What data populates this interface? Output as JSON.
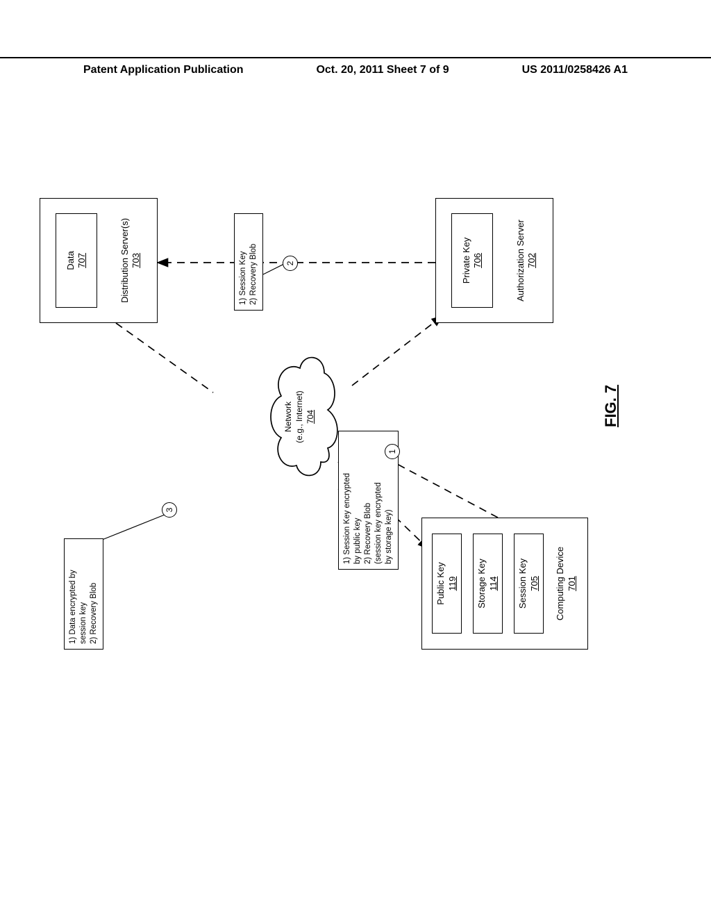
{
  "header": {
    "left": "Patent Application Publication",
    "center": "Oct. 20, 2011  Sheet 7 of 9",
    "right": "US 2011/0258426 A1"
  },
  "figure_label": "FIG. 7",
  "computing_device": {
    "label": "Computing Device",
    "ref": "701",
    "public_key": {
      "label": "Public Key",
      "ref": "119"
    },
    "storage_key": {
      "label": "Storage Key",
      "ref": "114"
    },
    "session_key": {
      "label": "Session Key",
      "ref": "705"
    }
  },
  "distribution_server": {
    "label": "Distribution Server(s)",
    "ref": "703",
    "data": {
      "label": "Data",
      "ref": "707"
    }
  },
  "authorization_server": {
    "label": "Authorization Server",
    "ref": "702",
    "private_key": {
      "label": "Private Key",
      "ref": "706"
    }
  },
  "network": {
    "label": "Network",
    "sub": "(e.g., Internet)",
    "ref": "704"
  },
  "annotations": {
    "step1": {
      "num": "1",
      "lines": [
        "1) Session Key encrypted",
        "by public key",
        "2) Recovery Blob",
        "(session key encrypted",
        "by storage key)"
      ]
    },
    "step2": {
      "num": "2",
      "lines": [
        "1) Session Key",
        "2) Recovery Blob"
      ]
    },
    "step3": {
      "num": "3",
      "lines": [
        "1) Data encrypted by",
        "session key",
        "2) Recovery Blob"
      ]
    }
  }
}
